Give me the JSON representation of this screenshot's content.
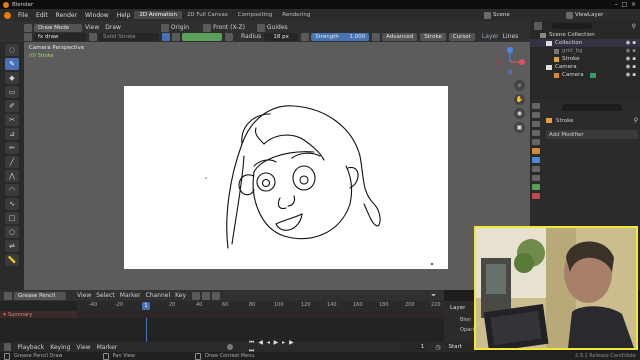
{
  "app": {
    "title": "Blender"
  },
  "menu": [
    "File",
    "Edit",
    "Render",
    "Window",
    "Help"
  ],
  "workspace_tabs": [
    "2D Animation",
    "2D Full Canvas",
    "Compositing",
    "Rendering"
  ],
  "active_workspace": "2D Animation",
  "scene_label": "Scene",
  "viewlayer_label": "ViewLayer",
  "header": {
    "mode": "Draw Mode",
    "menus": [
      "View",
      "Draw"
    ],
    "origin": "Origin",
    "view_plane": "Front (X-Z)",
    "guides": "Guides",
    "brush": "fx draw",
    "material": "Solid Stroke",
    "radius_label": "Radius",
    "radius_value": "18 px",
    "strength_label": "Strength",
    "strength_value": "1.000",
    "advanced": "Advanced",
    "stroke": "Stroke",
    "cursor": "Cursor",
    "layer": "Layer",
    "lines": "Lines"
  },
  "viewport": {
    "title": "Camera Perspective",
    "object": "(0) Stroke"
  },
  "outliner": {
    "root": "Scene Collection",
    "items": [
      {
        "label": "Collection",
        "level": 1
      },
      {
        "label": "grid_bg",
        "level": 2
      },
      {
        "label": "Stroke",
        "level": 2
      },
      {
        "label": "Camera",
        "level": 1
      },
      {
        "label": "Camera",
        "level": 2
      }
    ]
  },
  "properties": {
    "object": "Stroke",
    "add_modifier": "Add Modifier"
  },
  "timeline": {
    "mode": "Grease Pencil",
    "menus": [
      "View",
      "Select",
      "Marker",
      "Channel",
      "Key"
    ],
    "summary": "Summary",
    "ruler": [
      "-40",
      "-20",
      "1",
      "20",
      "40",
      "60",
      "80",
      "100",
      "120",
      "140",
      "160",
      "180",
      "200",
      "220"
    ],
    "current_frame": "1",
    "playback": "Playback",
    "keying": "Keying",
    "view": "View",
    "marker": "Marker",
    "frame_value": "1",
    "start_label": "Start"
  },
  "layer_panel": {
    "title": "Layer",
    "blend": "Blen",
    "opacity": "Opaci"
  },
  "status": {
    "left": "Grease Pencil Draw",
    "pan": "Pan View",
    "context": "Draw Context Menu",
    "version": "2.9.1 Release Candidate"
  },
  "colors": {
    "accent": "#4772b3",
    "active_green": "#9bd85b",
    "webcam_border": "#f2e63c"
  }
}
